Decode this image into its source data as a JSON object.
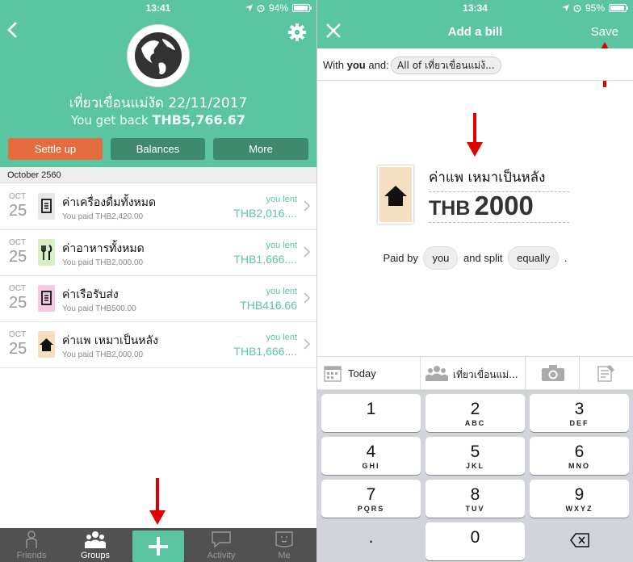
{
  "left": {
    "status": {
      "time": "13:41",
      "battery": "94%",
      "battery_level": 0.94
    },
    "group": {
      "name": "เที่ยวเขื่อนแม่งัด 22/11/2017",
      "balance_prefix": "You get back",
      "balance_amount": "THB5,766.67"
    },
    "buttons": {
      "settle": "Settle up",
      "balances": "Balances",
      "more": "More"
    },
    "month_header": "October 2560",
    "expenses": [
      {
        "month": "OCT",
        "day": "25",
        "name": "ค่าเครื่องดื่มทั้งหมด",
        "paid": "You paid THB2,420.00",
        "lent_label": "you lent",
        "amount": "THB2,016....",
        "icon": "receipt-icon",
        "color": "#e8e8e8"
      },
      {
        "month": "OCT",
        "day": "25",
        "name": "ค่าอาหารทั้งหมด",
        "paid": "You paid THB2,000.00",
        "lent_label": "you lent",
        "amount": "THB1,666....",
        "icon": "fork-knife-icon",
        "color": "#d7efc4"
      },
      {
        "month": "OCT",
        "day": "25",
        "name": "ค่าเรือรับส่ง",
        "paid": "You paid THB500.00",
        "lent_label": "you lent",
        "amount": "THB416.66",
        "icon": "receipt-icon",
        "color": "#f4c9e4"
      },
      {
        "month": "OCT",
        "day": "25",
        "name": "ค่าแพ เหมาเป็นหลัง",
        "paid": "You paid THB2,000.00",
        "lent_label": "you lent",
        "amount": "THB1,666....",
        "icon": "house-icon",
        "color": "#f6dfc0"
      }
    ],
    "tabs": [
      {
        "label": "Friends",
        "icon": "person-icon"
      },
      {
        "label": "Groups",
        "icon": "group-icon"
      },
      {
        "label": "",
        "icon": "plus-icon"
      },
      {
        "label": "Activity",
        "icon": "chat-bubble-icon"
      },
      {
        "label": "Me",
        "icon": "face-icon"
      }
    ]
  },
  "right": {
    "status": {
      "time": "13:34",
      "battery": "95%",
      "battery_level": 0.95
    },
    "title": "Add a bill",
    "save": "Save",
    "with_label": "With",
    "with_you": "you",
    "with_and": "and:",
    "with_chip": "All of เที่ยวเขื่อนแม่ง้...",
    "description": "ค่าแพ เหมาเป็นหลัง",
    "currency": "THB",
    "amount": "2000",
    "split": {
      "paid_by": "Paid by",
      "payer": "you",
      "and_split": "and split",
      "method": "equally",
      "period": "."
    },
    "toolbar": {
      "date": "Today",
      "group": "เที่ยวเขื่อนแม่..."
    },
    "keys": [
      {
        "n": "1",
        "l": ""
      },
      {
        "n": "2",
        "l": "ABC"
      },
      {
        "n": "3",
        "l": "DEF"
      },
      {
        "n": "4",
        "l": "GHI"
      },
      {
        "n": "5",
        "l": "JKL"
      },
      {
        "n": "6",
        "l": "MNO"
      },
      {
        "n": "7",
        "l": "PQRS"
      },
      {
        "n": "8",
        "l": "TUV"
      },
      {
        "n": "9",
        "l": "WXYZ"
      },
      {
        "n": ".",
        "l": ""
      },
      {
        "n": "0",
        "l": ""
      },
      {
        "n": "",
        "l": ""
      }
    ]
  },
  "colors": {
    "accent": "#5ac5a0",
    "settle": "#e46c3d",
    "dark_btn": "#3f8a6f",
    "arrow": "#e00000"
  }
}
